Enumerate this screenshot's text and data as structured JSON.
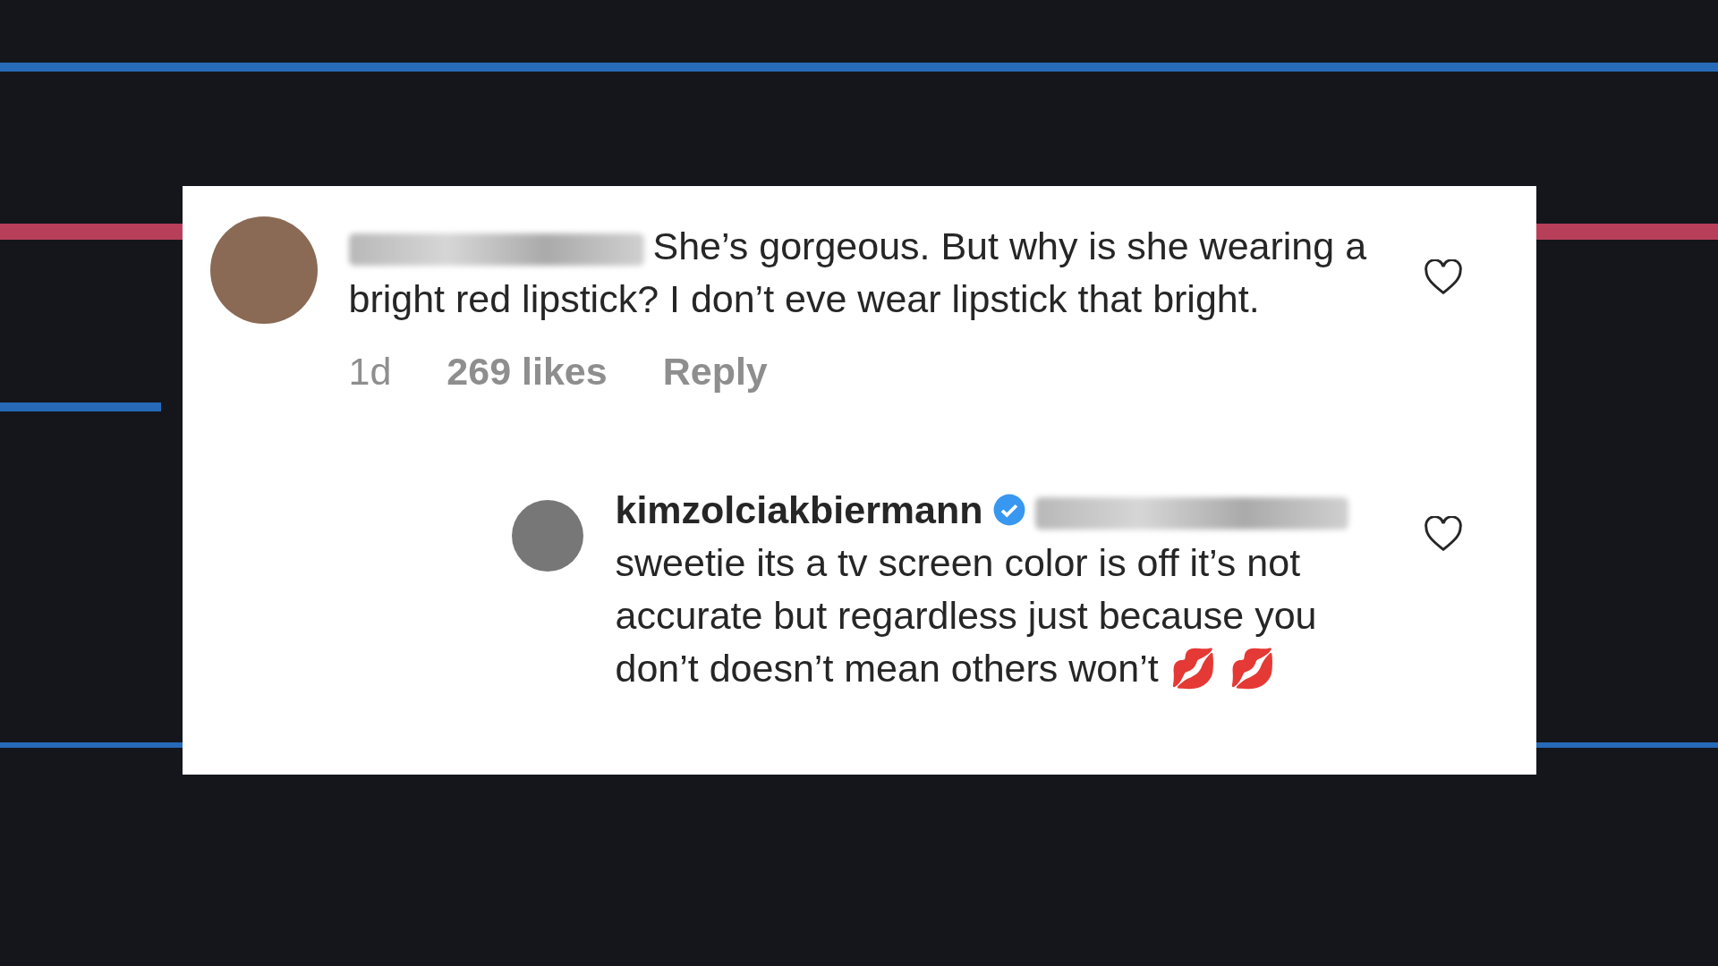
{
  "comments": [
    {
      "kind": "comment",
      "text": "She’s gorgeous. But why is she wearing a bright red lipstick? I don’t eve wear lipstick that bright.",
      "time": "1d",
      "likes": "269 likes",
      "reply": "Reply",
      "liked": false
    },
    {
      "kind": "reply",
      "username": "kimzolciakbiermann",
      "verified": true,
      "text": "sweetie its a tv screen color is off it’s not accurate but regardless just because you don’t doesn’t mean others won’t 💋 💋",
      "liked": false
    }
  ]
}
